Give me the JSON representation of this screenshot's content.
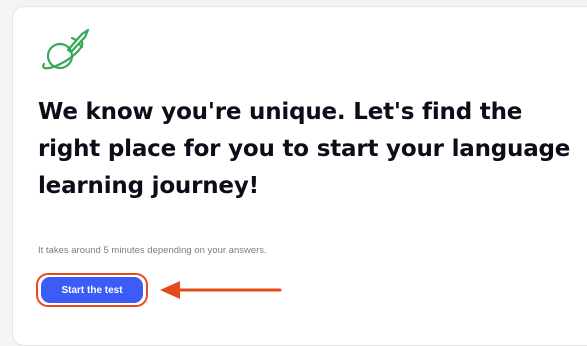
{
  "card": {
    "logo_icon": "rocket-orbit-icon",
    "headline": "We know you're unique. Let's find the right place for you to start your language learning journey!",
    "subtext": "It takes around 5 minutes depending on your answers.",
    "start_button_label": "Start the test"
  },
  "annotation": {
    "arrow_icon": "arrow-left-icon",
    "highlight_color": "#e64a1c"
  },
  "colors": {
    "accent": "#3b5cf5",
    "logo_green": "#3aa85a"
  }
}
